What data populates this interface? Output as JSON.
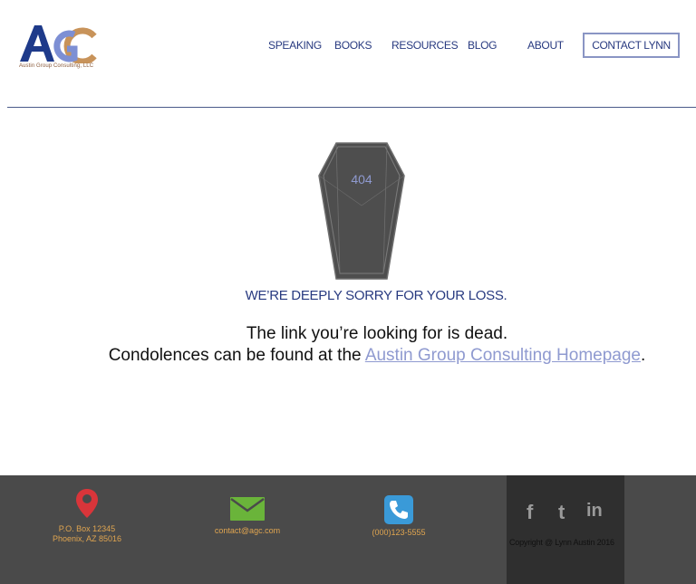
{
  "header": {
    "logo_text": "AGC",
    "logo_tagline": "Austin Group Consulting, LLC",
    "nav": [
      {
        "label": "SPEAKING"
      },
      {
        "label": "BOOKS"
      },
      {
        "label": "RESOURCES"
      },
      {
        "label": "BLOG"
      },
      {
        "label": "ABOUT"
      }
    ],
    "contact_button": "CONTACT LYNN"
  },
  "main": {
    "error_code": "404",
    "sorry_heading": "WE’RE DEEPLY SORRY FOR YOUR LOSS.",
    "message_line1": "The link you’re looking for is dead.",
    "message_line2_prefix": "Condolences can be found at the ",
    "homepage_link": "Austin Group Consulting Homepage",
    "message_line2_suffix": "."
  },
  "footer": {
    "address_line1": "P.O. Box 12345",
    "address_line2": "Phoenix, AZ 85016",
    "email": "contact@agc.com",
    "phone": "(000)123-5555",
    "social": [
      "f",
      "t",
      "in"
    ],
    "copyright_prefix": "Copyright @ Lynn Austin",
    "copyright_year": "2016"
  },
  "icons": [
    "location-pin-icon",
    "envelope-icon",
    "phone-icon",
    "facebook-icon",
    "twitter-icon",
    "linkedin-icon"
  ],
  "colors": {
    "brand_navy": "#283a80",
    "link_lavender": "#8f9ad0",
    "footer_bg": "#4a4a4a",
    "footer_text": "#e0a550",
    "pin_red": "#d9353a",
    "mail_green": "#6ab43a",
    "phone_blue": "#3a9ad8"
  }
}
